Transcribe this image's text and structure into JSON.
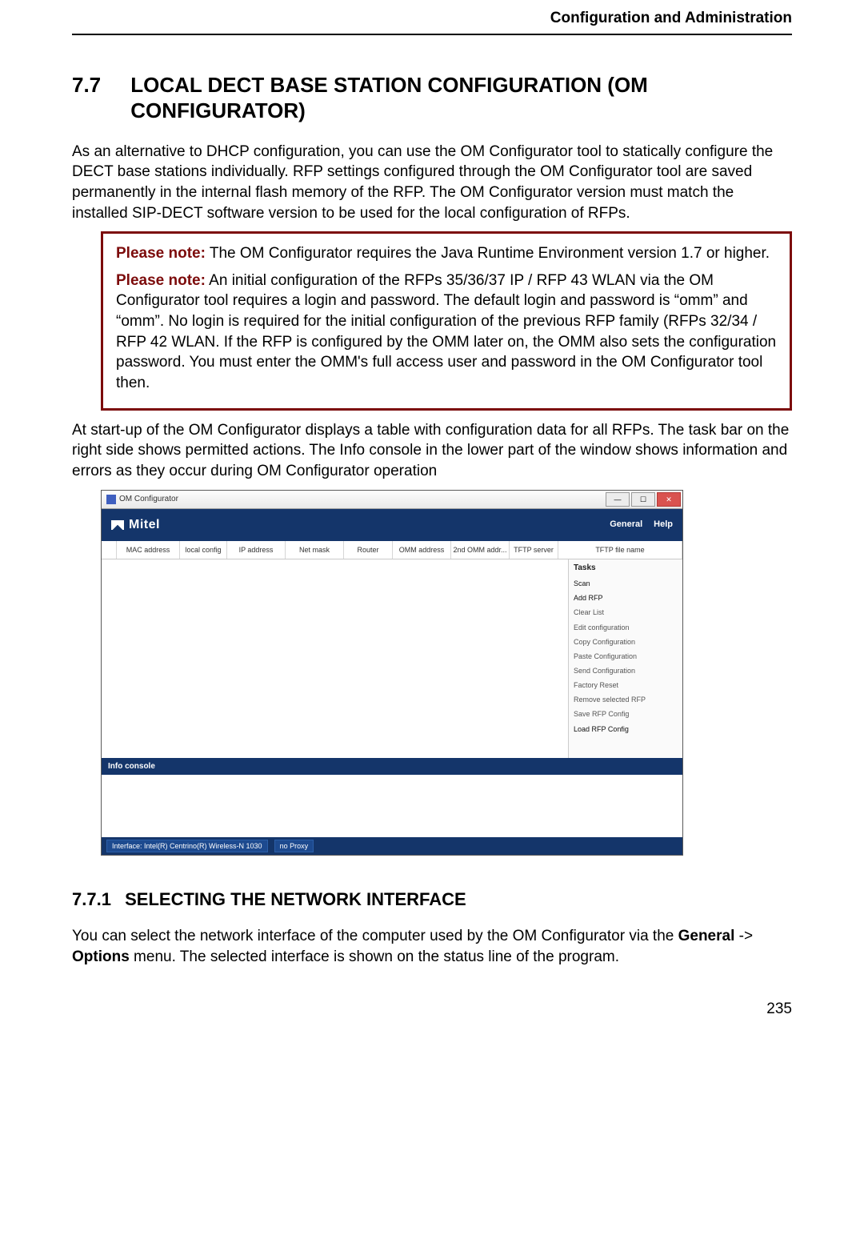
{
  "header": {
    "running_title": "Configuration and Administration"
  },
  "section": {
    "number": "7.7",
    "title": "LOCAL DECT BASE STATION CONFIGURATION (OM CONFIGURATOR)",
    "intro": "As an alternative to DHCP configuration, you can use the OM Configurator tool to statically configure the DECT base stations individually. RFP settings configured through the OM Configurator tool are saved permanently in the internal flash memory of the RFP. The OM Configurator version must match the installed SIP-DECT software version to be used for the local configuration of RFPs.",
    "notes": [
      {
        "label": "Please note:",
        "text": "The OM Configurator requires the Java Runtime Environment version 1.7 or higher."
      },
      {
        "label": "Please note:",
        "text": "An initial configuration of the RFPs 35/36/37 IP / RFP 43 WLAN via the OM Configurator tool requires a login and password. The default login and password is “omm” and “omm”. No login is required for the initial configuration of the previous RFP family (RFPs 32/34 / RFP 42 WLAN. If the RFP is configured by the OMM later on, the OMM also sets the configuration password. You must enter the OMM's full access user and password in the OM Configurator tool then."
      }
    ],
    "after_notes": "At start-up of the OM Configurator displays a table with configuration data for all RFPs. The task bar on the right side shows permitted actions. The Info console in the lower part of the window shows information and errors as they occur during OM Configurator operation"
  },
  "app": {
    "window_title": "OM Configurator",
    "brand": "Mitel",
    "menus": [
      "General",
      "Help"
    ],
    "columns": [
      "",
      "MAC address",
      "local config",
      "IP address",
      "Net mask",
      "Router",
      "OMM address",
      "2nd OMM addr...",
      "TFTP server",
      "TFTP file name"
    ],
    "tasks_header": "Tasks",
    "tasks": [
      {
        "label": "Scan",
        "enabled": true
      },
      {
        "label": "Add RFP",
        "enabled": true
      },
      {
        "label": "Clear List",
        "enabled": false
      },
      {
        "label": "Edit configuration",
        "enabled": false
      },
      {
        "label": "Copy Configuration",
        "enabled": false
      },
      {
        "label": "Paste Configuration",
        "enabled": false
      },
      {
        "label": "Send Configuration",
        "enabled": false
      },
      {
        "label": "Factory Reset",
        "enabled": false
      },
      {
        "label": "Remove selected RFP",
        "enabled": false
      },
      {
        "label": "Save RFP Config",
        "enabled": false
      },
      {
        "label": "Load RFP Config",
        "enabled": true
      }
    ],
    "info_header": "Info console",
    "status": {
      "interface": "Interface: Intel(R) Centrino(R) Wireless-N 1030",
      "proxy": "no Proxy"
    }
  },
  "subsection": {
    "number": "7.7.1",
    "title": "SELECTING THE NETWORK INTERFACE",
    "body_pre": "You can select the network interface of the computer used by the OM Configurator via the ",
    "bold1": "General",
    "arrow": " -> ",
    "bold2": "Options",
    "body_post": " menu.  The selected interface is shown on the status line of the program."
  },
  "footer": {
    "page_number": "235"
  }
}
